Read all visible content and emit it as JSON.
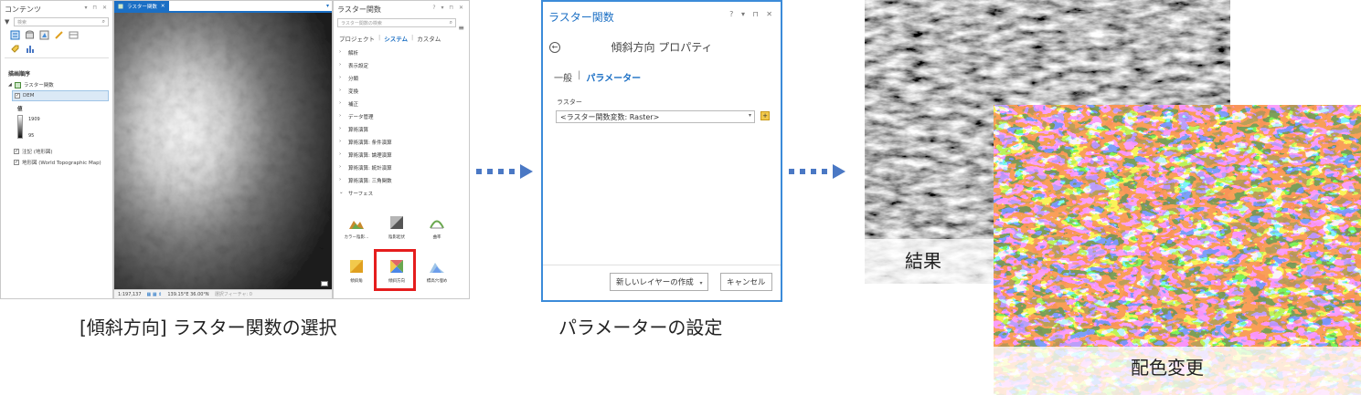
{
  "contents_pane": {
    "title": "コンテンツ",
    "window_controls": "▾ ⊓ ✕",
    "search_placeholder": "検索",
    "drawing_order_heading": "描画順序",
    "map_item": "ラスター関数",
    "layers": [
      {
        "name": "DEM",
        "checked": "✓",
        "selected": true
      },
      {
        "name": "注記 (地形図)",
        "checked": "✓",
        "selected": false
      },
      {
        "name": "地形図 (World Topographic Map)",
        "checked": "✓",
        "selected": false
      }
    ],
    "legend": {
      "heading": "値",
      "max": "1909",
      "min": "95"
    }
  },
  "map_view": {
    "tab_title": "ラスター関数",
    "tab_close": "✕",
    "scale": "1:197,137",
    "coordinates": "139.15°E 36.00°N",
    "selected_features": "選択フィーチャ: 0"
  },
  "raster_functions_pane": {
    "title": "ラスター関数",
    "window_controls": "? ▾ ⊓ ✕",
    "search_placeholder": "ラスター関数の検索",
    "tabs": {
      "project": "プロジェクト",
      "system": "システム",
      "custom": "カスタム"
    },
    "categories": [
      {
        "label": "解析",
        "arrow": "›"
      },
      {
        "label": "表示設定",
        "arrow": "›"
      },
      {
        "label": "分類",
        "arrow": "›"
      },
      {
        "label": "変換",
        "arrow": "›"
      },
      {
        "label": "補正",
        "arrow": "›"
      },
      {
        "label": "データ管理",
        "arrow": "›"
      },
      {
        "label": "算術演算",
        "arrow": "›"
      },
      {
        "label": "算術演算: 条件演算",
        "arrow": "›"
      },
      {
        "label": "算術演算: 論理演算",
        "arrow": "›"
      },
      {
        "label": "算術演算: 統計演算",
        "arrow": "›"
      },
      {
        "label": "算術演算: 三角関数",
        "arrow": "›"
      },
      {
        "label": "サーフェス",
        "arrow": "⌄"
      }
    ],
    "tiles": [
      {
        "label": "カラー陰影…",
        "icon": "color-hillshade-icon"
      },
      {
        "label": "陰影起伏",
        "icon": "hillshade-icon"
      },
      {
        "label": "曲率",
        "icon": "curvature-icon"
      },
      {
        "label": "傾斜角",
        "icon": "slope-icon"
      },
      {
        "label": "傾斜方向",
        "icon": "aspect-icon"
      },
      {
        "label": "標高穴埋め",
        "icon": "elevation-void-fill-icon"
      }
    ]
  },
  "dialog": {
    "title": "ラスター関数",
    "window_controls": "? ▾ ⊓ ✕",
    "back_icon": "←",
    "heading": "傾斜方向 プロパティ",
    "tab_general": "一般",
    "tab_separator": "|",
    "tab_parameters": "パラメーター",
    "raster_label": "ラスター",
    "raster_value": "<ラスター関数変数: Raster>",
    "add_icon": "+",
    "create_button": "新しいレイヤーの作成",
    "cancel_button": "キャンセル"
  },
  "captions": {
    "step1": "[傾斜方向] ラスター関数の選択",
    "step2": "パラメーターの設定",
    "result": "結果",
    "recolor": "配色変更"
  },
  "colors": {
    "accent": "#1b6fc4",
    "highlight": "#e51d1d",
    "arrow": "#4a78c4"
  }
}
